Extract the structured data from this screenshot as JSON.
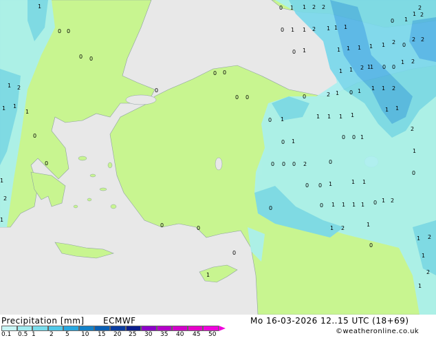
{
  "footer": {
    "title": "Precipitation [mm]",
    "model": "ECMWF",
    "datetime": "Mo 16-03-2026 12..15 UTC (18+69)",
    "credit": "©weatheronline.co.uk"
  },
  "legend": {
    "labels": [
      "0.1",
      "0.5",
      "1",
      "2",
      "5",
      "10",
      "15",
      "20",
      "25",
      "30",
      "35",
      "40",
      "45",
      "50"
    ],
    "colors": [
      "#c8f5f5",
      "#a0ebf0",
      "#78dcec",
      "#50c8e8",
      "#28a8e0",
      "#1482c8",
      "#0a5fb4",
      "#0a3ca0",
      "#0a1e8c",
      "#8c00c8",
      "#b400c8",
      "#d200c8",
      "#e600c8",
      "#f000dc"
    ]
  },
  "colors": {
    "sea": "#e8e8e8",
    "land": "#c8f590",
    "precip_light": "#aaf0f0",
    "precip_mid": "#78d8ec",
    "precip_heavy": "#50b4e6"
  },
  "map_values": {
    "labels": [
      "0",
      "1",
      "1",
      "2",
      "2",
      "0",
      "1",
      "1",
      "2",
      "2",
      "1",
      "1",
      "0",
      "1",
      "1",
      "2",
      "1",
      "0",
      "2",
      "2",
      "1",
      "1",
      "1",
      "2",
      "1",
      "1",
      "2",
      "2",
      "1",
      "0",
      "0",
      "1",
      "0",
      "1",
      "0",
      "0",
      "0",
      "1",
      "2",
      "1",
      "0",
      "1",
      "1",
      "1",
      "1",
      "2",
      "0",
      "1",
      "2",
      "1",
      "1",
      "1",
      "1",
      "1",
      "1",
      "1",
      "1",
      "0",
      "1",
      "1",
      "0",
      "0",
      "1",
      "0",
      "0",
      "0",
      "2",
      "0",
      "0",
      "0",
      "0",
      "0",
      "1",
      "0",
      "0",
      "1",
      "0",
      "0",
      "1",
      "1",
      "0",
      "1",
      "1",
      "1",
      "1",
      "2",
      "1",
      "1",
      "2",
      "0",
      "1",
      "2",
      "0",
      "1",
      "0",
      "0",
      "1",
      "0",
      "1",
      "2",
      "0",
      "1",
      "1",
      "2",
      "1",
      "2",
      "0",
      "0",
      "0",
      "0",
      "1",
      "1",
      "1"
    ]
  }
}
